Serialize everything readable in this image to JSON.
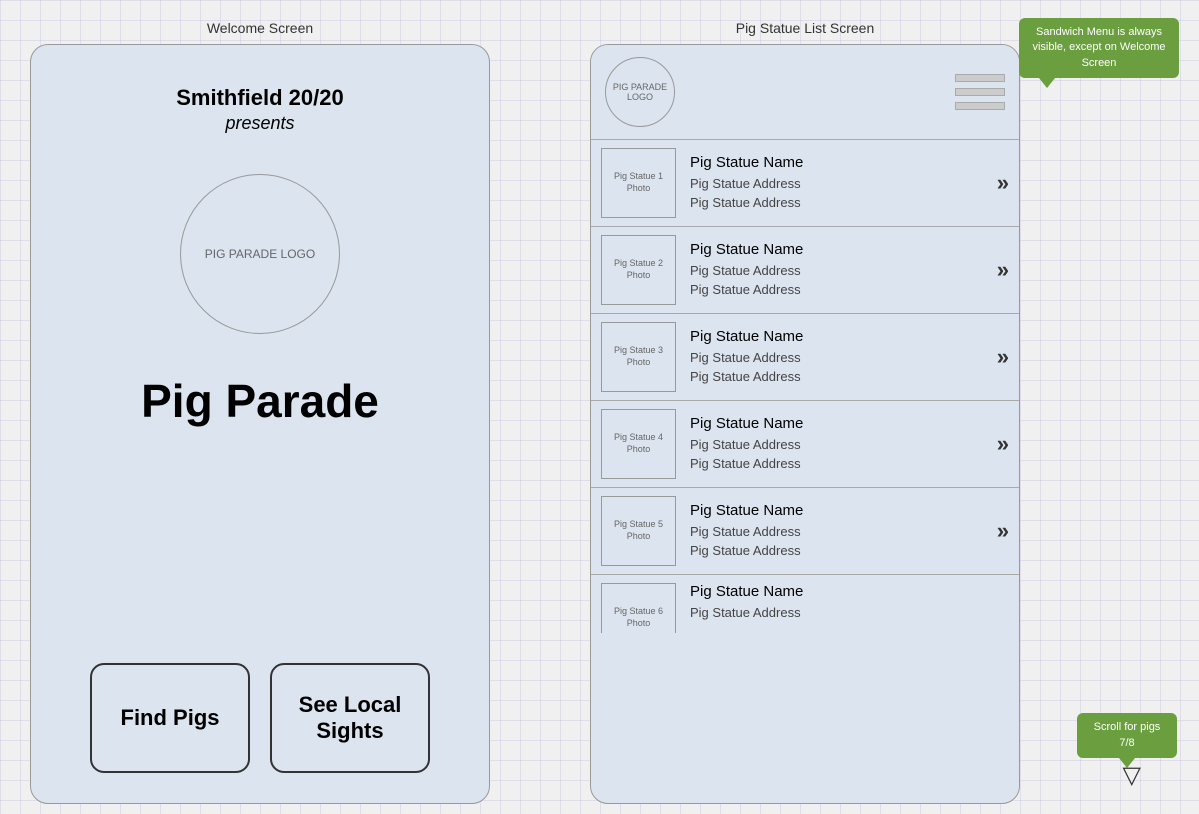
{
  "welcome": {
    "screen_label": "Welcome Screen",
    "title_bold": "Smithfield 20/20",
    "title_italic": "presents",
    "logo_text": "PIG PARADE\nLOGO",
    "app_name": "Pig Parade",
    "btn_find": "Find\nPigs",
    "btn_sights": "See Local\nSights"
  },
  "list_screen": {
    "screen_label": "Pig Statue List Screen",
    "header_logo_text": "PIG PARADE\nLOGO",
    "tooltip_sandwich": "Sandwich Menu is always visible, except on Welcome Screen",
    "tooltip_scroll": "Scroll for pigs 7/8",
    "items": [
      {
        "photo_label": "Pig Statue 1\nPhoto",
        "name": "Pig Statue Name",
        "address1": "Pig Statue Address",
        "address2": "Pig Statue Address"
      },
      {
        "photo_label": "Pig Statue 2\nPhoto",
        "name": "Pig Statue Name",
        "address1": "Pig Statue Address",
        "address2": "Pig Statue Address"
      },
      {
        "photo_label": "Pig Statue 3\nPhoto",
        "name": "Pig Statue Name",
        "address1": "Pig Statue Address",
        "address2": "Pig Statue Address"
      },
      {
        "photo_label": "Pig Statue 4\nPhoto",
        "name": "Pig Statue Name",
        "address1": "Pig Statue Address",
        "address2": "Pig Statue Address"
      },
      {
        "photo_label": "Pig Statue 5\nPhoto",
        "name": "Pig Statue Name",
        "address1": "Pig Statue Address",
        "address2": "Pig Statue Address"
      },
      {
        "photo_label": "Pig Statue 6\nPhoto",
        "name": "Pig Statue Name",
        "address1": "Pig Statue Address",
        "address2": ""
      }
    ]
  }
}
